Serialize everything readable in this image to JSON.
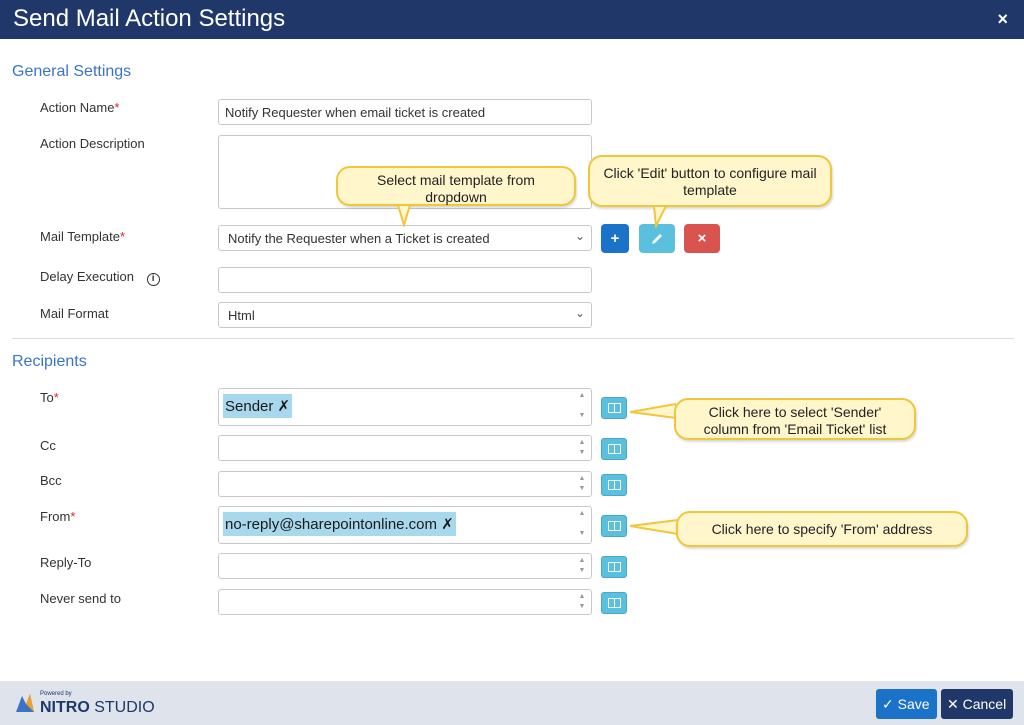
{
  "window": {
    "title": "Send Mail Action Settings",
    "close_glyph": "×"
  },
  "general": {
    "heading": "General Settings",
    "action_name_label": "Action Name",
    "action_name_value": "Notify Requester when email ticket is created",
    "action_description_label": "Action Description",
    "action_description_value": "",
    "mail_template_label": "Mail Template",
    "mail_template_value": "Notify the Requester when a Ticket is created",
    "add_glyph": "+",
    "delete_glyph": "×",
    "delay_execution_label": "Delay Execution",
    "delay_info_glyph": "i",
    "delay_execution_value": "",
    "mail_format_label": "Mail Format",
    "mail_format_value": "Html",
    "required_marker": "*"
  },
  "recipients": {
    "heading": "Recipients",
    "to_label": "To",
    "to_token": "Sender",
    "cc_label": "Cc",
    "bcc_label": "Bcc",
    "from_label": "From",
    "from_token": "no-reply@sharepointonline.com",
    "reply_to_label": "Reply-To",
    "never_send_label": "Never send to",
    "token_remove_glyph": "✗"
  },
  "callouts": {
    "template": "Select mail template from dropdown",
    "edit": "Click 'Edit' button to configure mail template",
    "sender": "Click here to select 'Sender' column from 'Email Ticket' list",
    "from": "Click here to specify 'From' address"
  },
  "footer": {
    "powered_by": "Powered by",
    "brand_bold": "NITRO",
    "brand_thin": "STUDIO",
    "save_label": "Save",
    "cancel_label": "Cancel"
  },
  "colors": {
    "titlebar": "#1f3869",
    "accent": "#3b74c6",
    "add": "#1a73c8",
    "edit": "#5bc0de",
    "delete": "#d9534f",
    "callout_border": "#f0c63a"
  },
  "icons": [
    "close-icon",
    "info-icon",
    "plus-icon",
    "pencil-icon",
    "delete-icon",
    "address-book-icon",
    "check-icon",
    "cancel-icon",
    "chevron-down-icon",
    "nitro-logo"
  ]
}
